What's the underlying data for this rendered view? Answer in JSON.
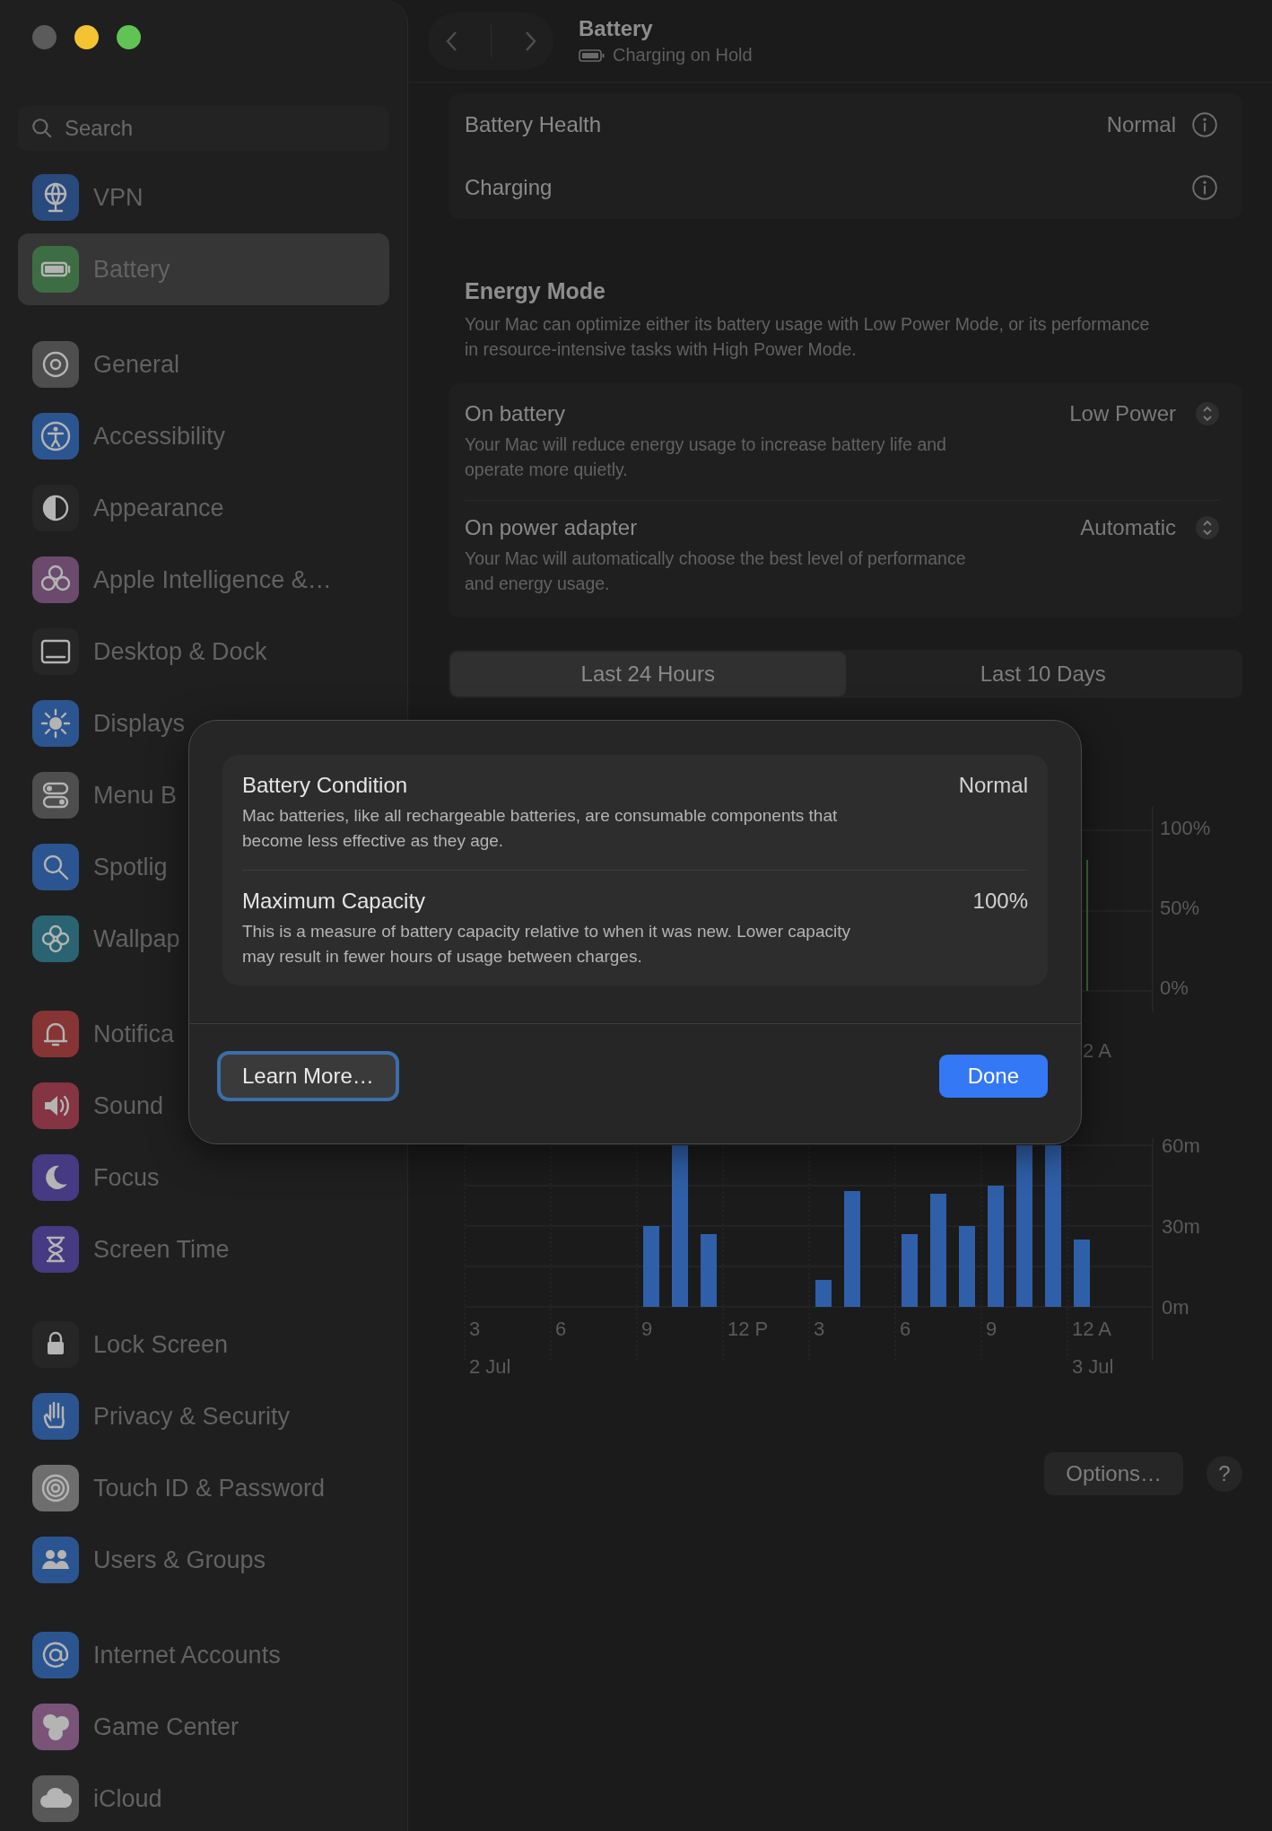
{
  "window": {
    "traffic_lights": [
      {
        "color": "#5b5b5b"
      },
      {
        "color": "#f4c331"
      },
      {
        "color": "#5fc454"
      }
    ]
  },
  "sidebar": {
    "search": {
      "placeholder": "Search"
    },
    "groups": [
      {
        "items": [
          {
            "label": "VPN",
            "color": "#294a7c",
            "selected": false
          },
          {
            "label": "Battery",
            "color": "#3d6e43",
            "selected": true
          }
        ]
      },
      {
        "items": [
          {
            "label": "General",
            "color": "#4e4e4e",
            "selected": false
          },
          {
            "label": "Accessibility",
            "color": "#2b5590",
            "selected": false
          },
          {
            "label": "Appearance",
            "color": "#262626",
            "selected": false
          },
          {
            "label": "Apple Intelligence &…",
            "color": "#6b4a6e",
            "selected": false
          },
          {
            "label": "Desktop & Dock",
            "color": "#262626",
            "selected": false
          },
          {
            "label": "Displays",
            "color": "#2b5590",
            "selected": false
          },
          {
            "label": "Menu B",
            "color": "#4e4e4e",
            "selected": false
          },
          {
            "label": "Spotlig",
            "color": "#2b5590",
            "selected": false
          },
          {
            "label": "Wallpap",
            "color": "#2a6472",
            "selected": false
          }
        ]
      },
      {
        "items": [
          {
            "label": "Notifica",
            "color": "#863434",
            "selected": false
          },
          {
            "label": "Sound",
            "color": "#843443",
            "selected": false
          },
          {
            "label": "Focus",
            "color": "#463a82",
            "selected": false
          },
          {
            "label": "Screen Time",
            "color": "#463a82",
            "selected": false
          }
        ]
      },
      {
        "items": [
          {
            "label": "Lock Screen",
            "color": "#262626",
            "selected": false
          },
          {
            "label": "Privacy & Security",
            "color": "#2b5590",
            "selected": false
          },
          {
            "label": "Touch ID & Password",
            "color": "#6e6e6e",
            "selected": false
          },
          {
            "label": "Users & Groups",
            "color": "#2b5590",
            "selected": false
          }
        ]
      },
      {
        "items": [
          {
            "label": "Internet Accounts",
            "color": "#2b5590",
            "selected": false
          },
          {
            "label": "Game Center",
            "color": "#7a5478",
            "selected": false
          },
          {
            "label": "iCloud",
            "color": "#585858",
            "selected": false
          }
        ]
      }
    ]
  },
  "toolbar": {
    "title": "Battery",
    "subtitle": "Charging on Hold"
  },
  "health_card": {
    "rows": [
      {
        "label": "Battery Health",
        "value": "Normal"
      },
      {
        "label": "Charging"
      }
    ]
  },
  "energy_mode": {
    "heading": "Energy Mode",
    "description": "Your Mac can optimize either its battery usage with Low Power Mode, or its performance in resource-intensive tasks with High Power Mode.",
    "settings": [
      {
        "title": "On battery",
        "description": "Your Mac will reduce energy usage to increase battery life and operate more quietly.",
        "value": "Low Power"
      },
      {
        "title": "On power adapter",
        "description": "Your Mac will automatically choose the best level of performance and energy usage.",
        "value": "Automatic"
      }
    ]
  },
  "period_tabs": [
    {
      "label": "Last 24 Hours",
      "selected": true
    },
    {
      "label": "Last 10 Days",
      "selected": false
    }
  ],
  "level_chart": {
    "tick_labels": [
      "100%",
      "50%",
      "0%"
    ],
    "x_label": "2 A"
  },
  "usage_chart": {
    "date_labels": [
      "2 Jul",
      "3 Jul"
    ],
    "chart_data": {
      "type": "bar",
      "categories": [
        "3",
        null,
        null,
        "6",
        null,
        null,
        "9",
        null,
        null,
        "12 P",
        null,
        null,
        "3",
        null,
        null,
        "6",
        null,
        null,
        "9",
        null,
        null,
        "12 A",
        null,
        null
      ],
      "series": [
        {
          "color": "#2f5fa8",
          "values": [
            0,
            0,
            0,
            0,
            0,
            0,
            30,
            60,
            27,
            0,
            0,
            0,
            10,
            43,
            0,
            27,
            42,
            30,
            45,
            60,
            60,
            25,
            0,
            0
          ]
        }
      ],
      "ylim": [
        0,
        60
      ],
      "yticks": [
        {
          "value": 0,
          "label": "0m"
        },
        {
          "value": 30,
          "label": "30m"
        },
        {
          "value": 60,
          "label": "60m"
        }
      ]
    }
  },
  "footer": {
    "options_button": "Options…",
    "help_button": "?"
  },
  "sheet": {
    "rows": [
      {
        "title": "Battery Condition",
        "value": "Normal",
        "description": "Mac batteries, like all rechargeable batteries, are consumable components that become less effective as they age."
      },
      {
        "title": "Maximum Capacity",
        "value": "100%",
        "description": "This is a measure of battery capacity relative to when it was new. Lower capacity may result in fewer hours of usage between charges."
      }
    ],
    "buttons": [
      {
        "label": "Learn More…",
        "kind": "secondary",
        "focused": true
      },
      {
        "label": "Done",
        "kind": "primary",
        "focused": false
      }
    ]
  }
}
